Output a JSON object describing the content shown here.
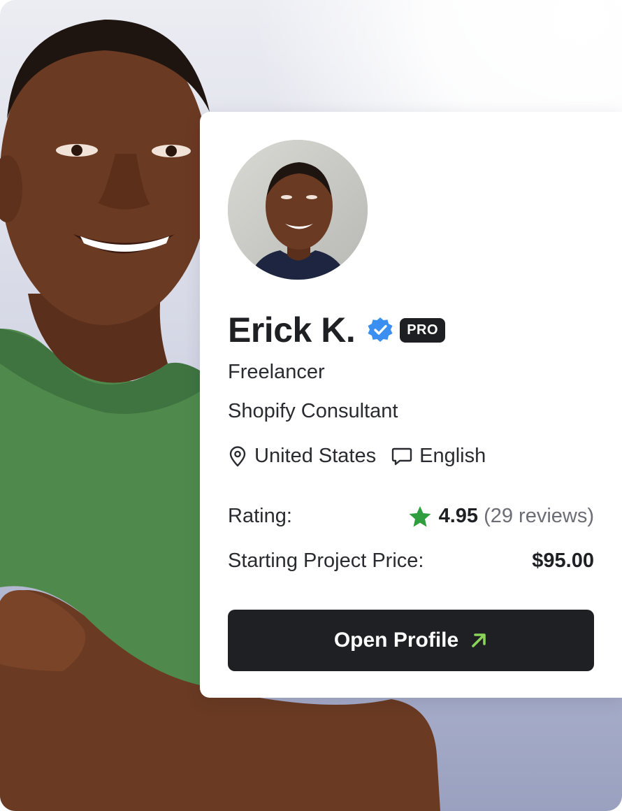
{
  "profile": {
    "name": "Erick K.",
    "badge": "PRO",
    "verified_icon": "verified-badge-icon",
    "role": "Freelancer",
    "specialty": "Shopify Consultant",
    "location": "United States",
    "language": "English"
  },
  "stats": {
    "rating_label": "Rating:",
    "rating_value": "4.95",
    "reviews": "(29 reviews)",
    "price_label": "Starting Project Price:",
    "price_value": "$95.00"
  },
  "cta": {
    "label": "Open Profile",
    "icon": "arrow-up-right-icon"
  },
  "colors": {
    "accent_green": "#8bd45a",
    "star_green": "#2e9e3e",
    "verified_blue": "#3a8ff0",
    "dark": "#1f2024"
  }
}
